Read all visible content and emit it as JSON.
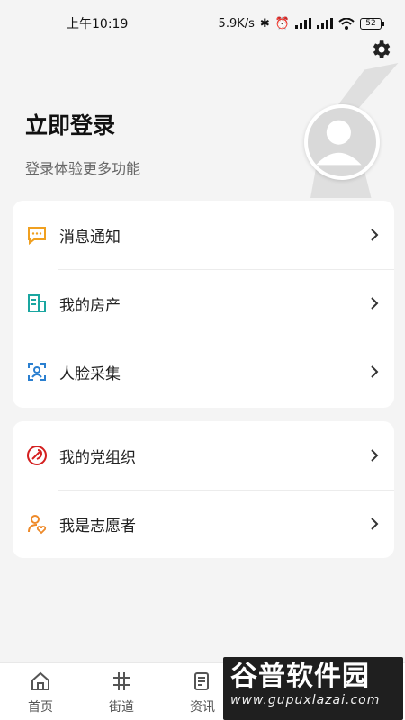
{
  "status_bar": {
    "time": "上午10:19",
    "network_speed": "5.9K/s",
    "battery": "52"
  },
  "header": {
    "title": "立即登录",
    "subtitle": "登录体验更多功能"
  },
  "menu_group_1": {
    "items": [
      {
        "label": "消息通知",
        "icon": "message-icon",
        "color": "#f0a020"
      },
      {
        "label": "我的房产",
        "icon": "building-icon",
        "color": "#1aa6a0"
      },
      {
        "label": "人脸采集",
        "icon": "face-scan-icon",
        "color": "#2a7fd0"
      }
    ]
  },
  "menu_group_2": {
    "items": [
      {
        "label": "我的党组织",
        "icon": "party-icon",
        "color": "#d42020"
      },
      {
        "label": "我是志愿者",
        "icon": "volunteer-icon",
        "color": "#ee8a2a"
      }
    ]
  },
  "bottom_nav": {
    "items": [
      {
        "label": "首页",
        "icon": "home-icon"
      },
      {
        "label": "街道",
        "icon": "street-icon"
      },
      {
        "label": "资讯",
        "icon": "news-icon"
      }
    ]
  },
  "watermark": {
    "title": "谷普软件园",
    "url": "www.gupuxlazai.com"
  }
}
